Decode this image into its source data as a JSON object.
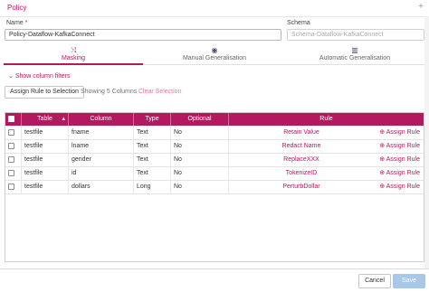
{
  "panel": {
    "title": "Policy",
    "add_icon": "plus-icon"
  },
  "form": {
    "name_label": "Name",
    "name_required": "*",
    "name_value": "Policy-Dataflow-KafkaConnect",
    "schema_label": "Schema",
    "schema_value": "Schema-Dataflow-KafkaConnect"
  },
  "tabs": [
    {
      "label": "Masking",
      "icon": "shuffle-icon",
      "active": true
    },
    {
      "label": "Manual Generalisation",
      "icon": "binoculars-icon",
      "active": false
    },
    {
      "label": "Automatic Generalisation",
      "icon": "columns-icon",
      "active": false
    }
  ],
  "filters": {
    "label": "Show column filters"
  },
  "toolbar": {
    "assign_label": "Assign Rule to Selection",
    "showing_label": "Showing 5 Columns",
    "clear_label": "Clear Selection"
  },
  "table": {
    "headers": {
      "table": "Table",
      "column": "Column",
      "type": "Type",
      "optional": "Optional",
      "rule": "Rule"
    },
    "assign_label": "Assign Rule",
    "rows": [
      {
        "table": "testfile",
        "column": "fname",
        "type": "Text",
        "optional": "No",
        "rule": "Retain Value"
      },
      {
        "table": "testfile",
        "column": "lname",
        "type": "Text",
        "optional": "No",
        "rule": "Redact Name"
      },
      {
        "table": "testfile",
        "column": "gender",
        "type": "Text",
        "optional": "No",
        "rule": "ReplaceXXX"
      },
      {
        "table": "testfile",
        "column": "id",
        "type": "Text",
        "optional": "No",
        "rule": "TokenizeID"
      },
      {
        "table": "testfile",
        "column": "dollars",
        "type": "Long",
        "optional": "No",
        "rule": "PerturbDollar"
      }
    ]
  },
  "footer": {
    "cancel_label": "Cancel",
    "save_label": "Save"
  },
  "colors": {
    "accent": "#b3195f",
    "save_disabled": "#a9c7e8"
  }
}
